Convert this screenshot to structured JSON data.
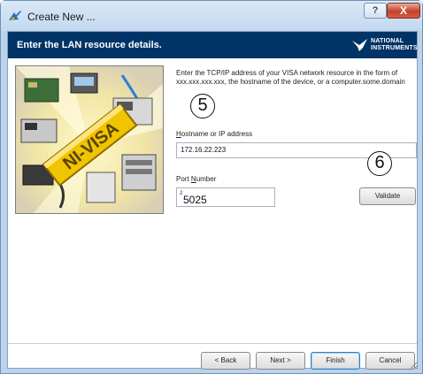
{
  "window": {
    "title": "Create New ...",
    "help_label": "?",
    "close_label": "X"
  },
  "header": {
    "text": "Enter the LAN resource details.",
    "logo_line1": "NATIONAL",
    "logo_line2": "INSTRUMENTS"
  },
  "content": {
    "description": "Enter the TCP/IP address of your VISA network resource in the form of xxx.xxx.xxx.xxx, the hostname of the device, or a computer.some.domain",
    "callouts": [
      "5",
      "6"
    ],
    "hostname": {
      "label_key": "H",
      "label_rest": "ostname or IP address",
      "value": "172.16.22.223"
    },
    "port": {
      "label_pre": "Port ",
      "label_key": "N",
      "label_rest": "umber",
      "small_value": "2",
      "value": "5025"
    },
    "validate_label": "Validate"
  },
  "footer": {
    "back_label": "< Back",
    "next_label": "Next >",
    "finish_label": "Finish",
    "cancel_label": "Cancel"
  }
}
